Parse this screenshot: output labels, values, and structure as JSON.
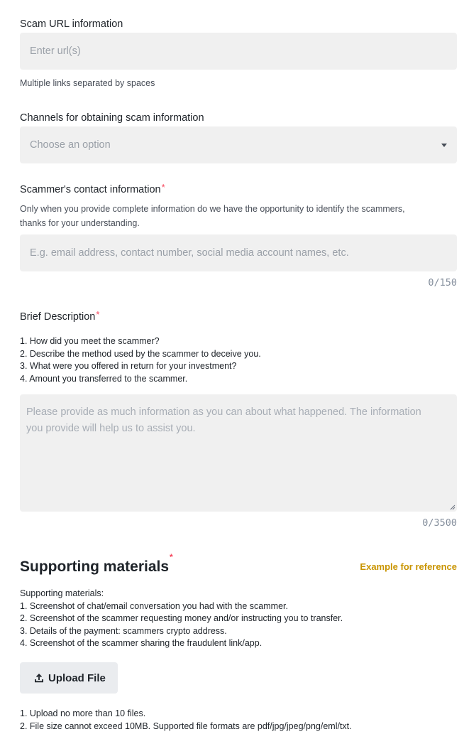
{
  "scam_url": {
    "label": "Scam URL information",
    "placeholder": "Enter url(s)",
    "hint": "Multiple links separated by spaces"
  },
  "channels": {
    "label": "Channels for obtaining scam information",
    "placeholder": "Choose an option"
  },
  "contact": {
    "label": "Scammer's contact information",
    "required_mark": "*",
    "hint_line1": "Only when you provide complete information do we have the opportunity to identify the scammers,",
    "hint_line2": "thanks for your understanding.",
    "placeholder": "E.g. email address, contact number, social media account names, etc.",
    "counter": "0/150"
  },
  "description": {
    "label": "Brief Description",
    "required_mark": "*",
    "questions": [
      "1. How did you meet the scammer?",
      "2. Describe the method used by the scammer to deceive you.",
      "3. What were you offered in return for your investment?",
      "4. Amount you transferred to the scammer."
    ],
    "placeholder_line1": "Please provide as much information as you can about what happened. The information",
    "placeholder_line2": "you provide will help us to assist you.",
    "counter": "0/3500"
  },
  "supporting": {
    "title": "Supporting materials",
    "required_mark": "*",
    "example_link": "Example for reference",
    "intro": "Supporting materials:",
    "items": [
      "1. Screenshot of chat/email conversation you had with the scammer.",
      "2. Screenshot of the scammer requesting money and/or instructing you to transfer.",
      "3. Details of the payment: scammers crypto address.",
      "4. Screenshot of the scammer sharing the fraudulent link/app."
    ],
    "upload_label": "Upload File",
    "upload_icon": "upload-icon",
    "rules": [
      "1. Upload no more than 10 files.",
      "2. File size cannot exceed 10MB. Supported file formats are pdf/jpg/jpeg/png/eml/txt."
    ]
  },
  "colors": {
    "required": "#f6465d",
    "link": "#c99400",
    "field_bg": "#f0f0f0"
  }
}
